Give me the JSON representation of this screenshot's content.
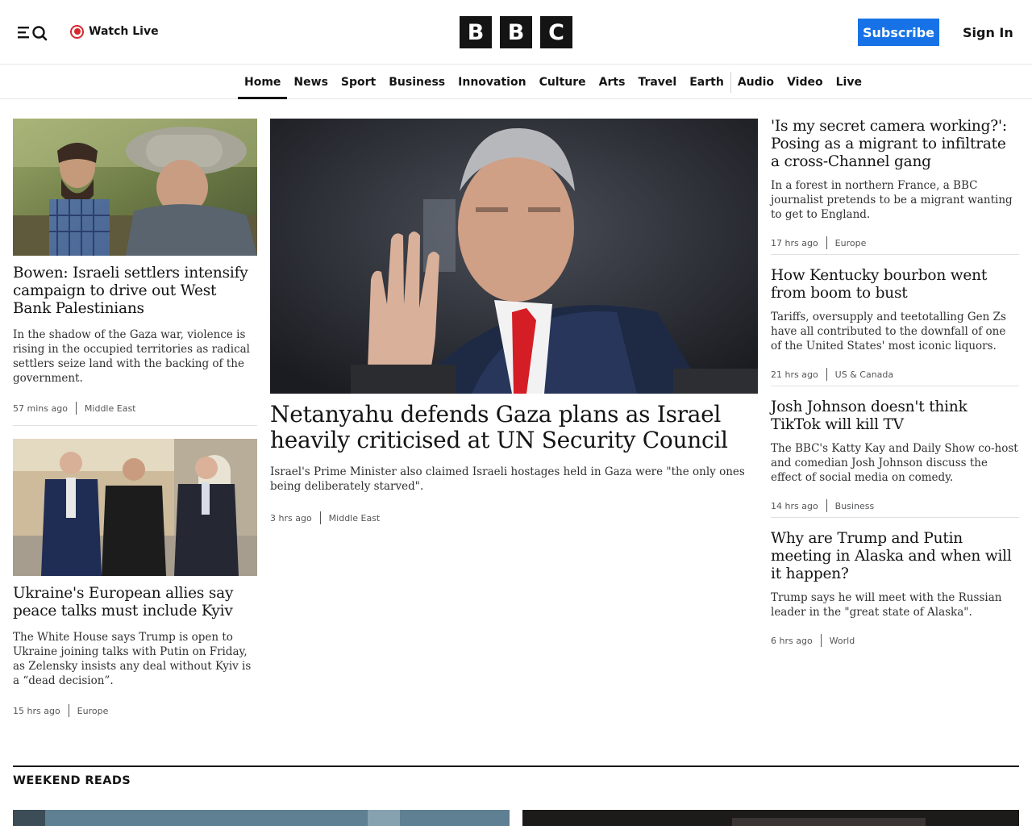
{
  "header": {
    "watch_live": "Watch Live",
    "logo_letters": [
      "B",
      "B",
      "C"
    ],
    "subscribe": "Subscribe",
    "sign_in": "Sign In"
  },
  "nav": {
    "items": [
      "Home",
      "News",
      "Sport",
      "Business",
      "Innovation",
      "Culture",
      "Arts",
      "Travel",
      "Earth",
      "Audio",
      "Video",
      "Live"
    ],
    "active": "Home"
  },
  "left_stories": [
    {
      "headline": "Bowen: Israeli settlers intensify campaign to drive out West Bank Palestinians",
      "summary": "In the shadow of the Gaza war, violence is rising in the occupied territories as radical settlers seize land with the backing of the government.",
      "time": "57 mins ago",
      "section": "Middle East"
    },
    {
      "headline": "Ukraine's European allies say peace talks must include Kyiv",
      "summary": "The White House says Trump is open to Ukraine joining talks with Putin on Friday, as Zelensky insists any deal without Kyiv is a “dead decision”.",
      "time": "15 hrs ago",
      "section": "Europe"
    }
  ],
  "lead_story": {
    "headline": "Netanyahu defends Gaza plans as Israel heavily criticised at UN Security Council",
    "summary": "Israel's Prime Minister also claimed Israeli hostages held in Gaza were \"the only ones being deliberately starved\".",
    "time": "3 hrs ago",
    "section": "Middle East"
  },
  "right_stories": [
    {
      "headline": "'Is my secret camera working?': Posing as a migrant to infiltrate a cross-Channel gang",
      "summary": "In a forest in northern France, a BBC journalist pretends to be a migrant wanting to get to England.",
      "time": "17 hrs ago",
      "section": "Europe"
    },
    {
      "headline": "How Kentucky bourbon went from boom to bust",
      "summary": "Tariffs, oversupply and teetotalling Gen Zs have all contributed to the downfall of one of the United States' most iconic liquors.",
      "time": "21 hrs ago",
      "section": "US & Canada"
    },
    {
      "headline": "Josh Johnson doesn't think TikTok will kill TV",
      "summary": "The BBC's Katty Kay and Daily Show co-host and comedian Josh Johnson discuss the effect of social media on comedy.",
      "time": "14 hrs ago",
      "section": "Business"
    },
    {
      "headline": "Why are Trump and Putin meeting in Alaska and when will it happen?",
      "summary": "Trump says he will meet with the Russian leader in the \"great state of Alaska\".",
      "time": "6 hrs ago",
      "section": "World"
    }
  ],
  "weekend_reads": {
    "title": "WEEKEND READS"
  },
  "colors": {
    "accent": "#1672e6",
    "live_red": "#d9272f",
    "text": "#141414"
  }
}
